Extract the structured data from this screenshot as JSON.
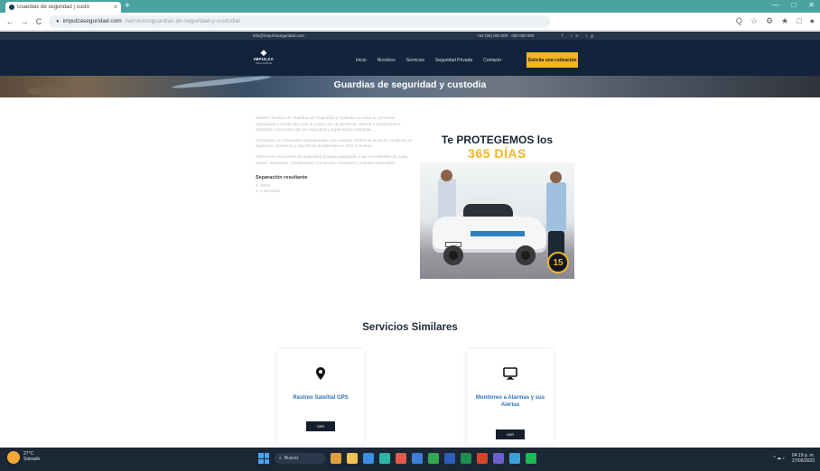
{
  "browser": {
    "tab_title": "Guardias de seguridad | custo",
    "tab_close": "×",
    "new_tab": "+",
    "url_host": "impulzaseguridad.com",
    "url_path": "/servicios/guardias-de-seguridad-y-custodia/",
    "nav_back": "←",
    "nav_forward": "→",
    "nav_reload": "C",
    "toolbar_icons": [
      "Q",
      "☆",
      "⚙",
      "★",
      "□",
      "●"
    ],
    "window_controls": [
      "—",
      "□",
      "✕"
    ]
  },
  "site": {
    "topbar_email": "info@impulzaseguridad.com",
    "topbar_phone": "+52 (55) 000 000 · 000 000 000",
    "topbar_social": "f in ig",
    "logo_mark": "◆",
    "logo_name": "IMPULZA",
    "logo_tagline": "SEGURIDAD",
    "menu": [
      "Inicio",
      "Nosotros",
      "Servicios",
      "Seguridad Privada",
      "Contacto"
    ],
    "cta": "Solicita una cotización",
    "hero_title": "Guardias de seguridad y custodia",
    "body_paragraphs": [
      "Nuestro servicio de Guardias de Seguridad y Custodia se basa en personal capacitado y certificado para la protección de personas, bienes e instalaciones, operando con protocolos de seguridad y supervisión constante.",
      "Contamos con elementos profesionales que realizan control de accesos, rondines de vigilancia, monitoreo y reporte de incidencias en todo momento.",
      "Ofrecemos soluciones de seguridad privada adaptadas a las necesidades de cada cliente: empresas, condominios, comercios, industrias y eventos especiales."
    ],
    "sub_heading": "Separación resultante",
    "sub_items": [
      "1. Otros",
      "2. A domicilio"
    ]
  },
  "promo": {
    "line1": "Te PROTEGEMOS los",
    "line2": "365 DÍAS",
    "badge": "15"
  },
  "similar": {
    "title": "Servicios Similares",
    "cards": [
      {
        "title": "Rastreo Satelital GPS",
        "button": "VER",
        "icon": "location-pin-icon"
      },
      {
        "title": "Monitoreo a Alarmas y sus Alertas",
        "button": "VER",
        "icon": "monitor-icon"
      }
    ]
  },
  "taskbar": {
    "weather_temp": "27°C",
    "weather_desc": "Soleado",
    "search": "Buscar",
    "time": "04:19 p. m.",
    "date": "27/06/2023",
    "tray_icons": "^ ☁ ♪"
  }
}
